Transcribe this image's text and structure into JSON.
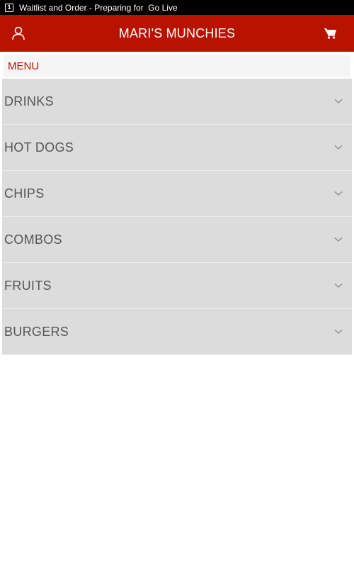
{
  "status_bar": {
    "notification_icon_text": "1",
    "text": "Waitlist and Order - Preparing for  Go Live"
  },
  "app_bar": {
    "title": "MARI'S MUNCHIES",
    "left_icon": "user-icon",
    "right_icon": "cart-icon",
    "color": "#b71300"
  },
  "menu": {
    "header_label": "MENU",
    "categories": [
      {
        "label": "DRINKS",
        "icon": "chevron-down-icon"
      },
      {
        "label": "HOT DOGS",
        "icon": "chevron-down-icon"
      },
      {
        "label": "CHIPS",
        "icon": "chevron-down-icon"
      },
      {
        "label": "COMBOS",
        "icon": "chevron-down-icon"
      },
      {
        "label": "FRUITS",
        "icon": "chevron-down-icon"
      },
      {
        "label": "BURGERS",
        "icon": "chevron-down-icon"
      }
    ]
  }
}
